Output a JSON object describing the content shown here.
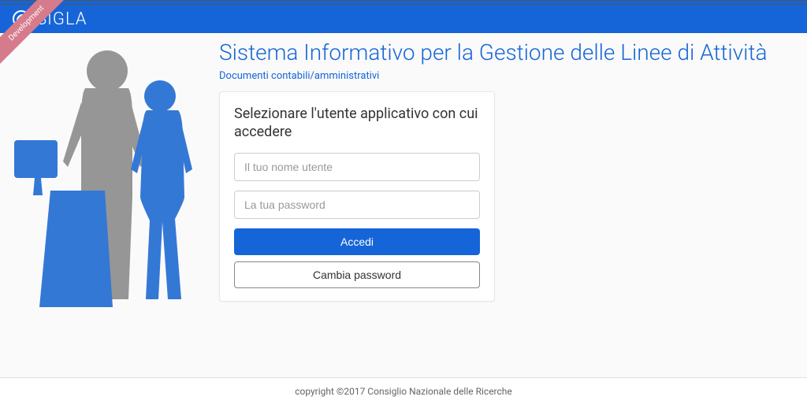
{
  "brand": {
    "name": "SIGLA"
  },
  "ribbon": {
    "label": "Development"
  },
  "page": {
    "title": "Sistema Informativo per la Gestione delle Linee di Attività",
    "subtitle": "Documenti contabili/amministrativi"
  },
  "login": {
    "card_title": "Selezionare l'utente applicativo con cui accedere",
    "username_placeholder": "Il tuo nome utente",
    "username_value": "",
    "password_placeholder": "La tua password",
    "password_value": "",
    "login_button": "Accedi",
    "change_password_button": "Cambia password"
  },
  "footer": {
    "text": "copyright ©2017 Consiglio Nazionale delle Ricerche"
  }
}
